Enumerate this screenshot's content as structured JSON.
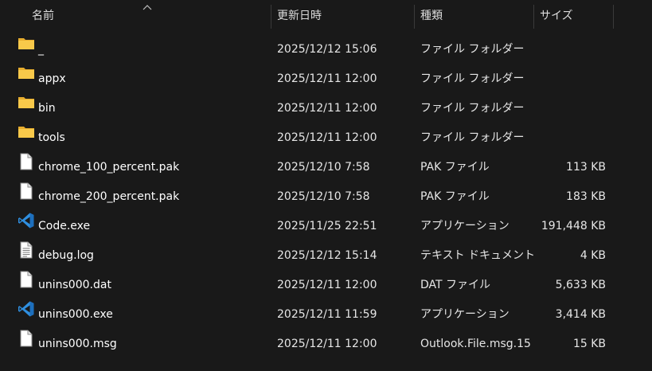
{
  "columns": {
    "name": "名前",
    "date": "更新日時",
    "type": "種類",
    "size": "サイズ"
  },
  "files": [
    {
      "icon": "folder-icon",
      "name": "_",
      "date": "2025/12/12 15:06",
      "type": "ファイル フォルダー",
      "size": ""
    },
    {
      "icon": "folder-icon",
      "name": "appx",
      "date": "2025/12/11 12:00",
      "type": "ファイル フォルダー",
      "size": ""
    },
    {
      "icon": "folder-icon",
      "name": "bin",
      "date": "2025/12/11 12:00",
      "type": "ファイル フォルダー",
      "size": ""
    },
    {
      "icon": "folder-icon",
      "name": "tools",
      "date": "2025/12/11 12:00",
      "type": "ファイル フォルダー",
      "size": ""
    },
    {
      "icon": "file-icon",
      "name": "chrome_100_percent.pak",
      "date": "2025/12/10 7:58",
      "type": "PAK ファイル",
      "size": "113 KB"
    },
    {
      "icon": "file-icon",
      "name": "chrome_200_percent.pak",
      "date": "2025/12/10 7:58",
      "type": "PAK ファイル",
      "size": "183 KB"
    },
    {
      "icon": "vscode-icon",
      "name": "Code.exe",
      "date": "2025/11/25 22:51",
      "type": "アプリケーション",
      "size": "191,448 KB"
    },
    {
      "icon": "text-file-icon",
      "name": "debug.log",
      "date": "2025/12/12 15:14",
      "type": "テキスト ドキュメント",
      "size": "4 KB"
    },
    {
      "icon": "file-icon",
      "name": "unins000.dat",
      "date": "2025/12/11 12:00",
      "type": "DAT ファイル",
      "size": "5,633 KB"
    },
    {
      "icon": "vscode-icon",
      "name": "unins000.exe",
      "date": "2025/12/11 11:59",
      "type": "アプリケーション",
      "size": "3,414 KB"
    },
    {
      "icon": "file-icon",
      "name": "unins000.msg",
      "date": "2025/12/11 12:00",
      "type": "Outlook.File.msg.15",
      "size": "15 KB"
    }
  ],
  "colors": {
    "background": "#191919",
    "folder": "#f8c94a",
    "vscode": "#2f8fe0"
  }
}
